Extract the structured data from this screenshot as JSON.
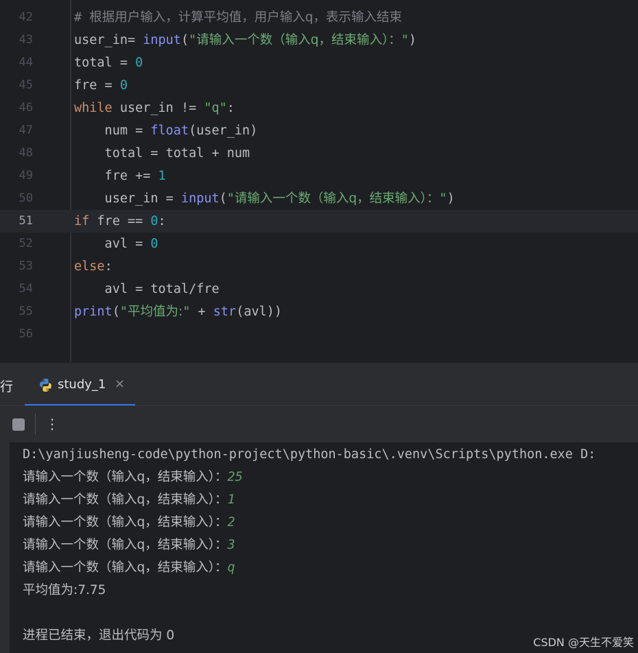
{
  "editor": {
    "current_line": "51",
    "lines": [
      {
        "num": "42",
        "tokens": [
          {
            "t": "# ",
            "c": "cm"
          },
          {
            "t": "根据用户输入，计算平均值，用户输入q，表示输入结束",
            "c": "cm cn"
          }
        ]
      },
      {
        "num": "43",
        "tokens": [
          {
            "t": "user_in= ",
            "c": ""
          },
          {
            "t": "input",
            "c": "fn"
          },
          {
            "t": "(",
            "c": ""
          },
          {
            "t": "\"",
            "c": "str"
          },
          {
            "t": "请输入一个数（输入q，结束输入）：",
            "c": "str cn"
          },
          {
            "t": "\"",
            "c": "str"
          },
          {
            "t": ")",
            "c": ""
          }
        ]
      },
      {
        "num": "44",
        "tokens": [
          {
            "t": "total = ",
            "c": ""
          },
          {
            "t": "0",
            "c": "num"
          }
        ]
      },
      {
        "num": "45",
        "tokens": [
          {
            "t": "fre = ",
            "c": ""
          },
          {
            "t": "0",
            "c": "num"
          }
        ]
      },
      {
        "num": "46",
        "tokens": [
          {
            "t": "while",
            "c": "kw"
          },
          {
            "t": " user_in != ",
            "c": ""
          },
          {
            "t": "\"q\"",
            "c": "str"
          },
          {
            "t": ":",
            "c": ""
          }
        ]
      },
      {
        "num": "47",
        "tokens": [
          {
            "t": "    num = ",
            "c": ""
          },
          {
            "t": "float",
            "c": "fn"
          },
          {
            "t": "(user_in)",
            "c": ""
          }
        ]
      },
      {
        "num": "48",
        "tokens": [
          {
            "t": "    total = total + num",
            "c": ""
          }
        ]
      },
      {
        "num": "49",
        "tokens": [
          {
            "t": "    fre += ",
            "c": ""
          },
          {
            "t": "1",
            "c": "num"
          }
        ]
      },
      {
        "num": "50",
        "tokens": [
          {
            "t": "    user_in = ",
            "c": ""
          },
          {
            "t": "input",
            "c": "fn"
          },
          {
            "t": "(",
            "c": ""
          },
          {
            "t": "\"",
            "c": "str"
          },
          {
            "t": "请输入一个数（输入q，结束输入）：",
            "c": "str cn"
          },
          {
            "t": "\"",
            "c": "str"
          },
          {
            "t": ")",
            "c": ""
          }
        ]
      },
      {
        "num": "51",
        "tokens": [
          {
            "t": "if",
            "c": "kw"
          },
          {
            "t": " fre == ",
            "c": ""
          },
          {
            "t": "0",
            "c": "num"
          },
          {
            "t": ":",
            "c": ""
          }
        ]
      },
      {
        "num": "52",
        "tokens": [
          {
            "t": "    avl = ",
            "c": ""
          },
          {
            "t": "0",
            "c": "num"
          }
        ]
      },
      {
        "num": "53",
        "tokens": [
          {
            "t": "else",
            "c": "kw"
          },
          {
            "t": ":",
            "c": ""
          }
        ]
      },
      {
        "num": "54",
        "tokens": [
          {
            "t": "    avl = total/fre",
            "c": ""
          }
        ]
      },
      {
        "num": "55",
        "tokens": [
          {
            "t": "print",
            "c": "fn"
          },
          {
            "t": "(",
            "c": ""
          },
          {
            "t": "\"",
            "c": "str"
          },
          {
            "t": "平均值为:",
            "c": "str cn"
          },
          {
            "t": "\"",
            "c": "str"
          },
          {
            "t": " + ",
            "c": ""
          },
          {
            "t": "str",
            "c": "fn"
          },
          {
            "t": "(avl))",
            "c": ""
          }
        ]
      },
      {
        "num": "56",
        "tokens": []
      }
    ]
  },
  "run_panel": {
    "title": "行",
    "tab_label": "study_1",
    "tab_close": "×",
    "more_label": "⋮",
    "icons": {
      "tab": "python-icon",
      "stop": "stop-icon",
      "more": "more-vertical-icon",
      "close": "close-icon"
    }
  },
  "console": {
    "command": "D:\\yanjiusheng-code\\python-project\\python-basic\\.venv\\Scripts\\python.exe D:",
    "prompt": "请输入一个数（输入q，结束输入）：",
    "inputs": [
      "25",
      "1",
      "2",
      "3",
      "q"
    ],
    "result": "平均值为:7.75",
    "exit_message": "进程已结束，退出代码为 0"
  },
  "watermark": "CSDN @天生不爱笑",
  "colors": {
    "keyword": "#cf8e6d",
    "function": "#8891f5",
    "string": "#6aab73",
    "number": "#2aacb8",
    "comment": "#7a7e85",
    "user_input": "#5fa068",
    "accent": "#3574f0"
  }
}
